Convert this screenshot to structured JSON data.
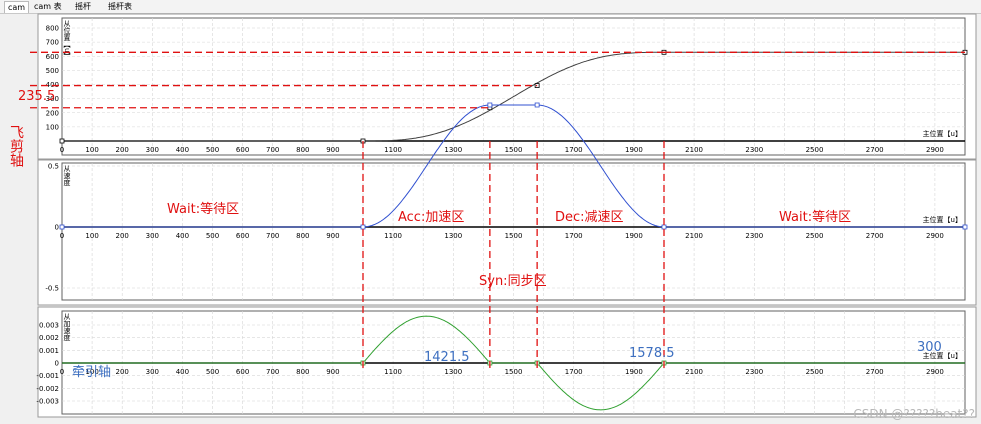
{
  "tabs": [
    "cam",
    "cam 表",
    "摇杆",
    "摇杆表"
  ],
  "xlabel": "主位置【u】",
  "ylabel": "从位置【u】",
  "xticks": [
    0,
    100,
    200,
    300,
    400,
    500,
    600,
    700,
    800,
    900,
    1100,
    1300,
    1500,
    1700,
    1900,
    2100,
    2300,
    2500,
    2700,
    2900
  ],
  "colors": {
    "position": "#404040",
    "velocity": "#3050d0",
    "acceleration": "#30a030",
    "markers": "#e01010"
  },
  "chart_data": [
    {
      "type": "line",
      "name": "position",
      "xlabel": "主位置【u】",
      "ylabel": "从位置【u】",
      "xlim": [
        0,
        3000
      ],
      "ylim": [
        0,
        880
      ],
      "yticks": [
        100,
        200,
        300,
        400,
        500,
        600,
        700,
        800
      ],
      "x": [
        0,
        1000,
        1421.5,
        1578.5,
        2000,
        3000
      ],
      "y": [
        0,
        0,
        235.5,
        392.5,
        628,
        628
      ],
      "grid": true
    },
    {
      "type": "line",
      "name": "velocity",
      "xlabel": "主位置【u】",
      "ylabel": "从速度",
      "xlim": [
        0,
        3000
      ],
      "ylim": [
        -1.3,
        1.0
      ],
      "yticks": [
        0.5,
        0,
        -0.5,
        -1
      ],
      "ytick_labels": [
        "0.5",
        "0",
        "-0.5",
        "-1"
      ],
      "x": [
        0,
        1000,
        1421.5,
        1578.5,
        2000,
        3000
      ],
      "y": [
        0,
        0,
        1,
        1,
        0,
        0
      ],
      "grid": true
    },
    {
      "type": "line",
      "name": "acceleration",
      "xlabel": "主位置【u】",
      "ylabel": "从加速度",
      "xlim": [
        0,
        3000
      ],
      "ylim": [
        -0.004,
        0.004
      ],
      "yticks": [
        0.003,
        0.002,
        0.001,
        0,
        -0.001,
        -0.002,
        -0.003
      ],
      "ytick_labels": [
        "0.003",
        "0.002",
        "0.001",
        "0",
        "-0.001",
        "-0.002",
        "-0.003"
      ],
      "x": [
        0,
        1000,
        1210,
        1421.5,
        1578.5,
        1790,
        2000,
        3000
      ],
      "y": [
        0,
        0,
        0.0037,
        0,
        0,
        -0.0037,
        0,
        0
      ],
      "grid": true
    }
  ],
  "annotations": {
    "fly_axis": "飞剪轴",
    "value_235": "235.5",
    "wait_left": "Wait:等待区",
    "acc": "Acc:加速区",
    "dec": "Dec:减速区",
    "wait_right": "Wait:等待区",
    "syn": "Syn:同步区",
    "traction_axis": "牵引轴",
    "x_1421": "1421.5",
    "x_1578": "1578.5",
    "val_300": "300",
    "watermark": "CSDN @?????beat??"
  }
}
